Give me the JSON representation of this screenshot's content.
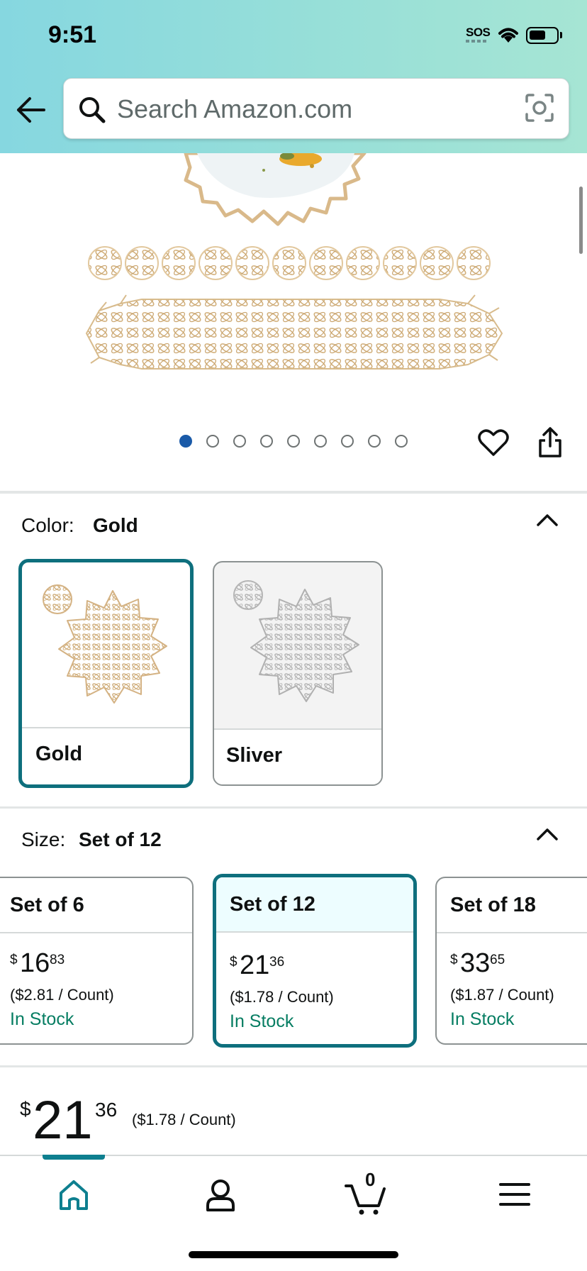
{
  "status_bar": {
    "time": "9:51",
    "sos": "SOS"
  },
  "search": {
    "placeholder": "Search Amazon.com"
  },
  "gallery": {
    "image_count": 9,
    "active_index": 0
  },
  "color": {
    "label": "Color:",
    "selected": "Gold",
    "options": [
      {
        "name": "Gold",
        "selected": true
      },
      {
        "name": "Sliver",
        "selected": false
      }
    ]
  },
  "size": {
    "label": "Size:",
    "selected": "Set of 12",
    "options": [
      {
        "title": "Set of 6",
        "currency": "$",
        "whole": "16",
        "fraction": "83",
        "unit_price": "($2.81 / Count)",
        "stock": "In Stock",
        "selected": false
      },
      {
        "title": "Set of 12",
        "currency": "$",
        "whole": "21",
        "fraction": "36",
        "unit_price": "($1.78 / Count)",
        "stock": "In Stock",
        "selected": true
      },
      {
        "title": "Set of 18",
        "currency": "$",
        "whole": "33",
        "fraction": "65",
        "unit_price": "($1.87 / Count)",
        "stock": "In Stock",
        "selected": false
      }
    ]
  },
  "price": {
    "currency": "$",
    "whole": "21",
    "fraction": "36",
    "unit_price": "($1.78 / Count)"
  },
  "nav": {
    "items": [
      {
        "icon": "home-icon",
        "active": true
      },
      {
        "icon": "account-icon",
        "active": false
      },
      {
        "icon": "cart-icon",
        "active": false
      },
      {
        "icon": "menu-icon",
        "active": false
      }
    ],
    "cart_count": "0"
  },
  "colors": {
    "accent": "#0e6f7d",
    "stock_green": "#067d62",
    "dot_active": "#1a5aa8",
    "gold": "#d9b98a"
  }
}
